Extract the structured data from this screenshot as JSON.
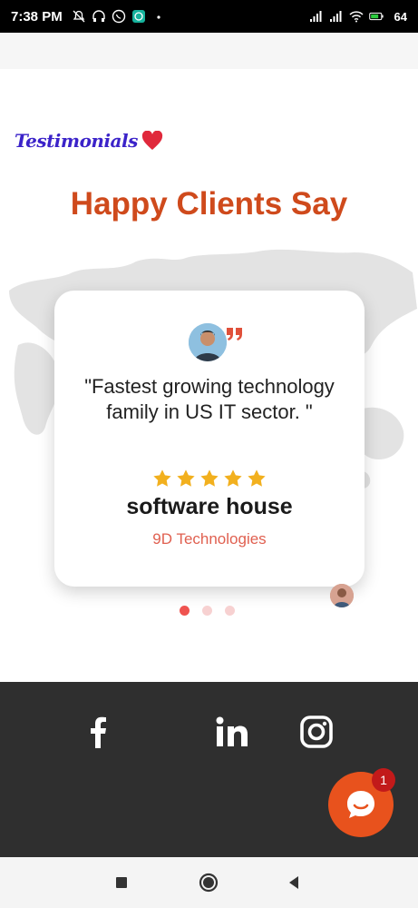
{
  "status_bar": {
    "time": "7:38 PM",
    "battery_percent": "64",
    "icons": [
      "mute-icon",
      "headset-icon",
      "whatsapp-icon",
      "messenger-icon",
      "dot-icon",
      "signal-icon",
      "signal-icon",
      "wifi-icon",
      "battery-icon"
    ]
  },
  "testimonials": {
    "eyebrow": "Testimonials",
    "heading": "Happy Clients Say",
    "card": {
      "quote": "\"Fastest growing technology family in US IT sector. \"",
      "rating": 5,
      "name": "software house",
      "company": "9D Technologies"
    },
    "carousel": {
      "total": 3,
      "active": 1
    }
  },
  "footer": {
    "social": [
      "facebook-icon",
      "linkedin-icon",
      "instagram-icon"
    ]
  },
  "chat": {
    "badge_count": "1"
  },
  "colors": {
    "accent": "#cf4a1c",
    "eyebrow": "#3b23c9",
    "heart": "#e0283b",
    "star": "#f2b01e",
    "footer_bg": "#2f2f2f",
    "chat_bg": "#e8521d",
    "dot_active": "#ef5350"
  }
}
